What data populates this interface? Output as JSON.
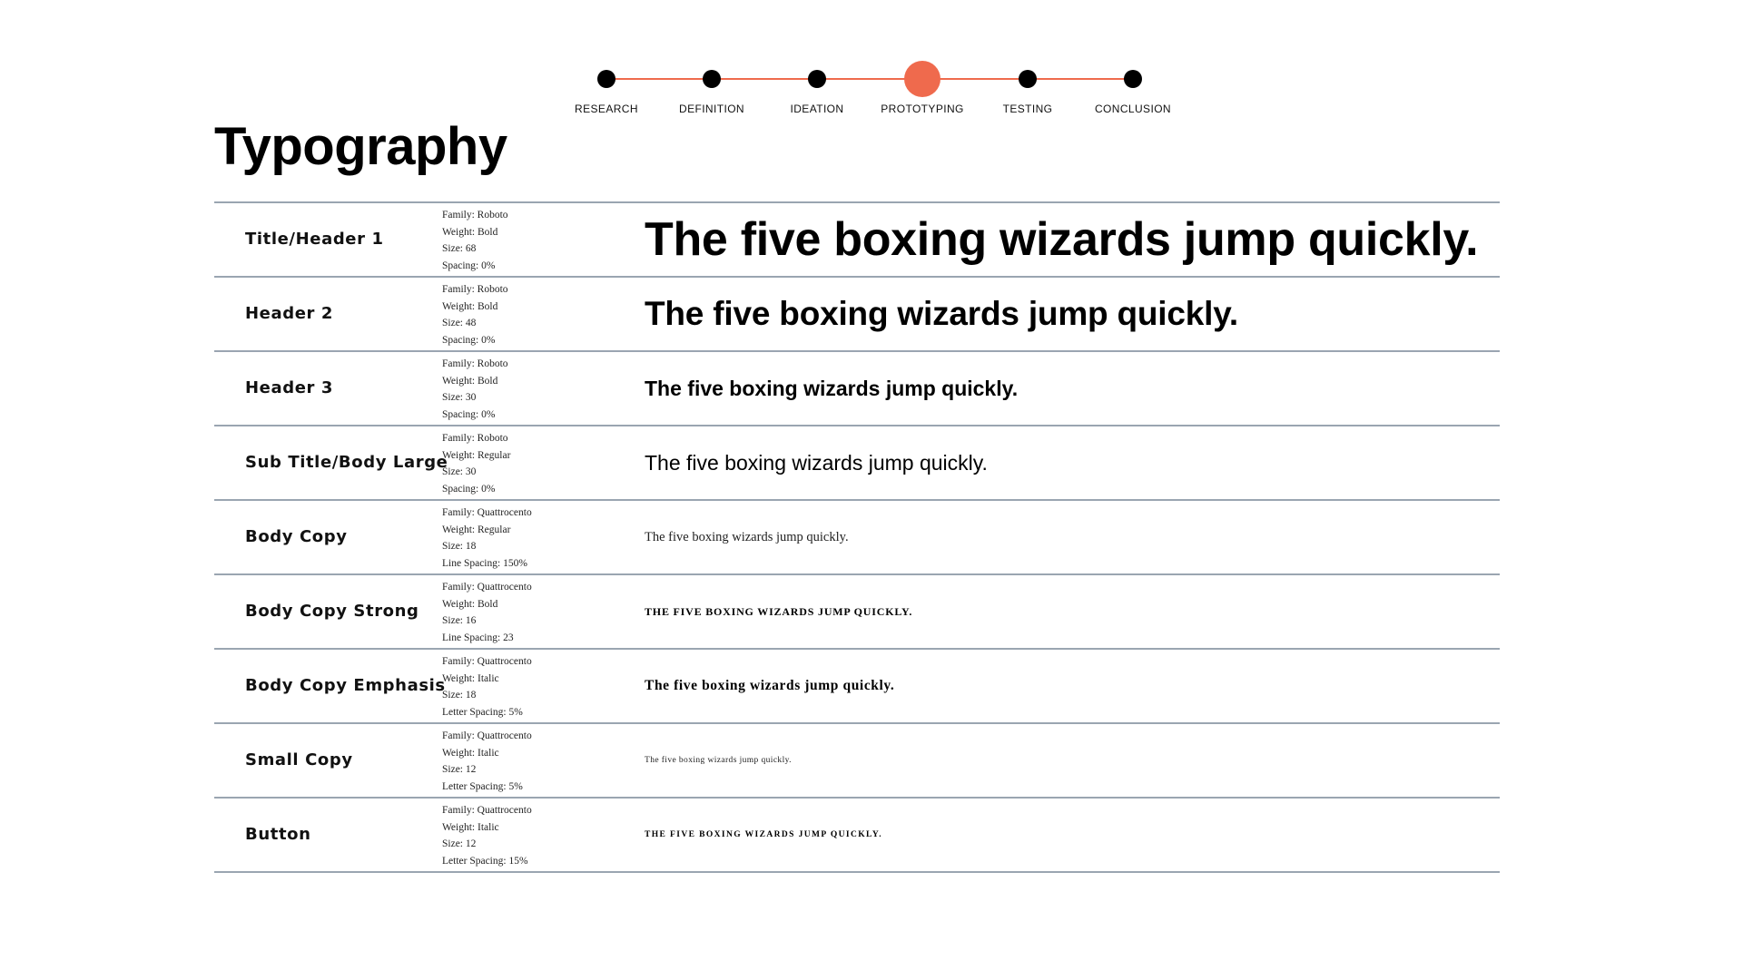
{
  "stepper": {
    "steps": [
      {
        "label": "RESEARCH",
        "active": false
      },
      {
        "label": "DEFINITION",
        "active": false
      },
      {
        "label": "IDEATION",
        "active": false
      },
      {
        "label": "PROTOTYPING",
        "active": true
      },
      {
        "label": "TESTING",
        "active": false
      },
      {
        "label": "CONCLUSION",
        "active": false
      }
    ],
    "active_color": "#ef6a4d",
    "dot_color": "#000000"
  },
  "page": {
    "title": "Typography"
  },
  "type_scale": {
    "rows": [
      {
        "name": "Title/Header 1",
        "specs": [
          "Family: Roboto",
          "Weight: Bold",
          "Size: 68",
          "Spacing: 0%"
        ],
        "sample": "The five boxing wizards jump quickly."
      },
      {
        "name": "Header 2",
        "specs": [
          "Family: Roboto",
          "Weight: Bold",
          "Size: 48",
          "Spacing: 0%"
        ],
        "sample": "The five boxing wizards jump quickly."
      },
      {
        "name": "Header 3",
        "specs": [
          "Family: Roboto",
          "Weight: Bold",
          "Size: 30",
          "Spacing: 0%"
        ],
        "sample": "The five boxing wizards jump quickly."
      },
      {
        "name": "Sub Title/Body Large",
        "specs": [
          "Family: Roboto",
          "Weight: Regular",
          "Size: 30",
          "Spacing: 0%"
        ],
        "sample": "The five boxing wizards jump quickly."
      },
      {
        "name": "Body Copy",
        "specs": [
          "Family: Quattrocento",
          "Weight: Regular",
          "Size: 18",
          "Line Spacing: 150%"
        ],
        "sample": "The five boxing wizards jump quickly."
      },
      {
        "name": "Body Copy Strong",
        "specs": [
          "Family: Quattrocento",
          "Weight: Bold",
          "Size: 16",
          "Line Spacing: 23"
        ],
        "sample": "THE FIVE BOXING WIZARDS JUMP QUICKLY."
      },
      {
        "name": "Body Copy Emphasis",
        "specs": [
          "Family: Quattrocento",
          "Weight: Italic",
          "Size: 18",
          "Letter Spacing: 5%"
        ],
        "sample": "The five boxing wizards jump quickly."
      },
      {
        "name": "Small Copy",
        "specs": [
          "Family: Quattrocento",
          "Weight: Italic",
          "Size: 12",
          "Letter Spacing: 5%"
        ],
        "sample": "The five boxing wizards jump quickly."
      },
      {
        "name": "Button",
        "specs": [
          "Family: Quattrocento",
          "Weight: Italic",
          "Size: 12",
          "Letter Spacing: 15%"
        ],
        "sample": "THE FIVE BOXING WIZARDS JUMP QUICKLY."
      }
    ]
  }
}
